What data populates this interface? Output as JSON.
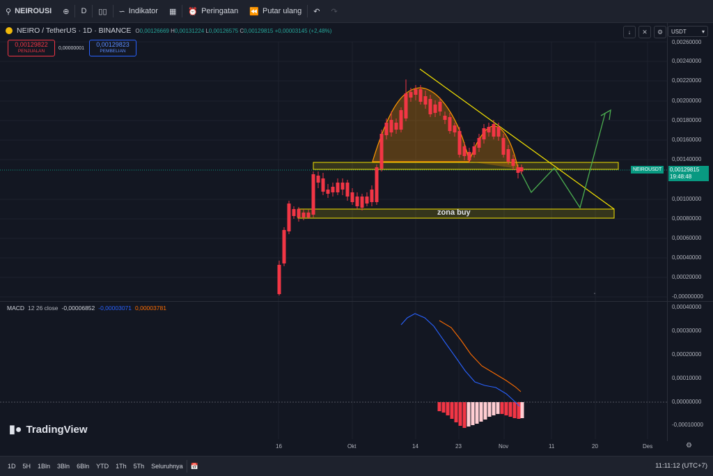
{
  "toolbar": {
    "symbol": "NEIROUSI",
    "interval": "D",
    "indicators_label": "Indikator",
    "alerts_label": "Peringatan",
    "replay_label": "Putar ulang"
  },
  "legend": {
    "title": "NEIRO / TetherUS · 1D · BINANCE",
    "open_label": "O",
    "open": "0,00126669",
    "high_label": "H",
    "high": "0,00131224",
    "low_label": "L",
    "low": "0,00126575",
    "close_label": "C",
    "close": "0,00129815",
    "change": "+0,00003145 (+2,48%)"
  },
  "trade": {
    "sell_price": "0,00129822",
    "sell_label": "PENJUALAN",
    "spread": "0,00000001",
    "buy_price": "0,00129823",
    "buy_label": "PEMBELIAN"
  },
  "currency": "USDT",
  "price_axis": {
    "ticks": [
      "0,00260000",
      "0,00240000",
      "0,00220000",
      "0,00200000",
      "0,00180000",
      "0,00160000",
      "0,00140000",
      "0,00100000",
      "0,00080000",
      "0,00060000",
      "0,00040000",
      "0,00020000",
      "-0,00000000"
    ],
    "current_ticker": "NEIROUSDT",
    "current_price": "0,00129815",
    "countdown": "19:48:48"
  },
  "macd_axis": {
    "ticks": [
      "0,00040000",
      "0,00030000",
      "0,00020000",
      "0,00010000",
      "0,00000000",
      "-0,00010000"
    ]
  },
  "macd_legend": {
    "name": "MACD",
    "params": "12 26 close",
    "hist": "-0,00006852",
    "macd": "-0,00003071",
    "signal": "0,00003781"
  },
  "annotation": "zona buy",
  "time_axis": [
    "16",
    "Okt",
    "14",
    "23",
    "Nov",
    "11",
    "20",
    "Des"
  ],
  "bottom": {
    "ranges": [
      "1D",
      "5H",
      "1Bln",
      "3Bln",
      "6Bln",
      "YTD",
      "1Th",
      "5Th",
      "Seluruhnya"
    ],
    "clock": "11:11:12 (UTC+7)"
  },
  "brand": "TradingView",
  "colors": {
    "up": "#089981",
    "down": "#f23645",
    "macd": "#2962ff",
    "signal": "#ff6d00",
    "zone": "#f7e500"
  }
}
